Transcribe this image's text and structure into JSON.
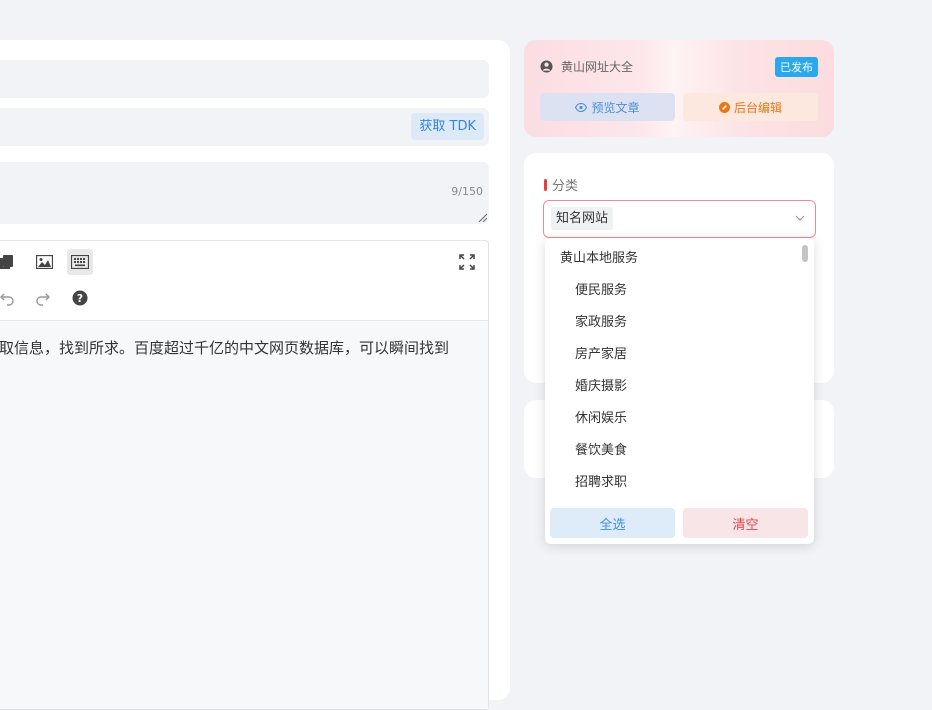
{
  "form": {
    "tdk_button": "获取 TDK",
    "desc_counter": "9/150"
  },
  "editor": {
    "content_text": "取信息，找到所求。百度超过千亿的中文网页数据库，可以瞬间找到"
  },
  "publish": {
    "site_name": "黄山网址大全",
    "status_badge": "已发布",
    "preview_label": "预览文章",
    "edit_label": "后台编辑",
    "badge_color": "#29a8ee"
  },
  "category": {
    "label": "分类",
    "selected_tag": "知名网站",
    "dropdown": {
      "group": "黄山本地服务",
      "items": [
        "便民服务",
        "家政服务",
        "房产家居",
        "婚庆摄影",
        "休闲娱乐",
        "餐饮美食",
        "招聘求职"
      ],
      "select_all": "全选",
      "clear": "清空"
    }
  }
}
